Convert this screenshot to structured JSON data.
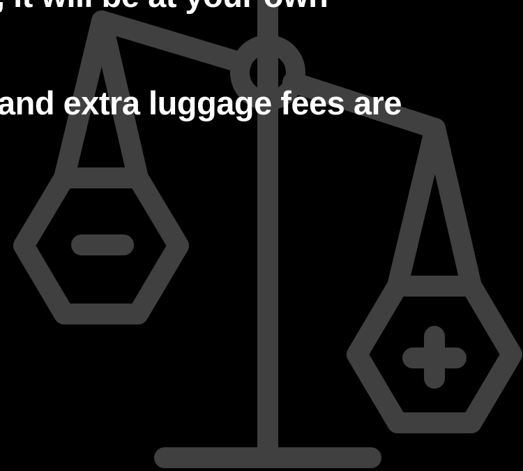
{
  "text_lines": [
    ", it will be at your own",
    "and extra luggage fees are"
  ],
  "illustration": {
    "icon": "balance-scale-icon",
    "left_pan_symbol": "minus-icon",
    "right_pan_symbol": "plus-icon"
  },
  "colors": {
    "background": "#000000",
    "text": "#ffffff",
    "icon": "#404040"
  }
}
